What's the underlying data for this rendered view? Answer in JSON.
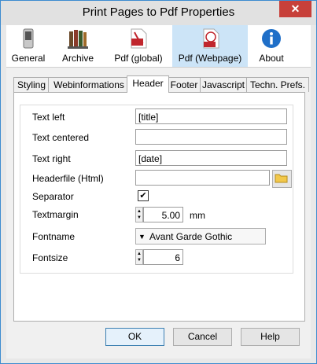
{
  "window": {
    "title": "Print Pages to Pdf Properties",
    "close": "✕"
  },
  "toolbar": {
    "items": [
      {
        "label": "General",
        "icon": "switch-icon"
      },
      {
        "label": "Archive",
        "icon": "books-icon"
      },
      {
        "label": "Pdf (global)",
        "icon": "pdf-icon"
      },
      {
        "label": "Pdf (Webpage)",
        "icon": "pdf-web-icon"
      },
      {
        "label": "About",
        "icon": "info-icon"
      }
    ],
    "active": "Pdf (Webpage)"
  },
  "tabs": [
    {
      "label": "Styling"
    },
    {
      "label": "Webinformations"
    },
    {
      "label": "Header"
    },
    {
      "label": "Footer"
    },
    {
      "label": "Javascript"
    },
    {
      "label": "Techn. Prefs."
    }
  ],
  "active_tab": "Header",
  "form": {
    "text_left_label": "Text left",
    "text_left_value": "[title]",
    "text_centered_label": "Text centered",
    "text_centered_value": "",
    "text_right_label": "Text right",
    "text_right_value": "[date]",
    "headerfile_label": "Headerfile (Html)",
    "headerfile_value": "",
    "separator_label": "Separator",
    "separator_checked": "✔",
    "textmargin_label": "Textmargin",
    "textmargin_value": "5.00",
    "textmargin_unit": "mm",
    "fontname_label": "Fontname",
    "fontname_value": "Avant Garde Gothic",
    "fontsize_label": "Fontsize",
    "fontsize_value": "6"
  },
  "buttons": {
    "ok": "OK",
    "cancel": "Cancel",
    "help": "Help"
  },
  "colors": {
    "accent": "#cce4f7",
    "titlebar": "#e1e1e1",
    "close": "#c7403a",
    "pdf": "#c0262d",
    "info": "#1f6fc8"
  }
}
